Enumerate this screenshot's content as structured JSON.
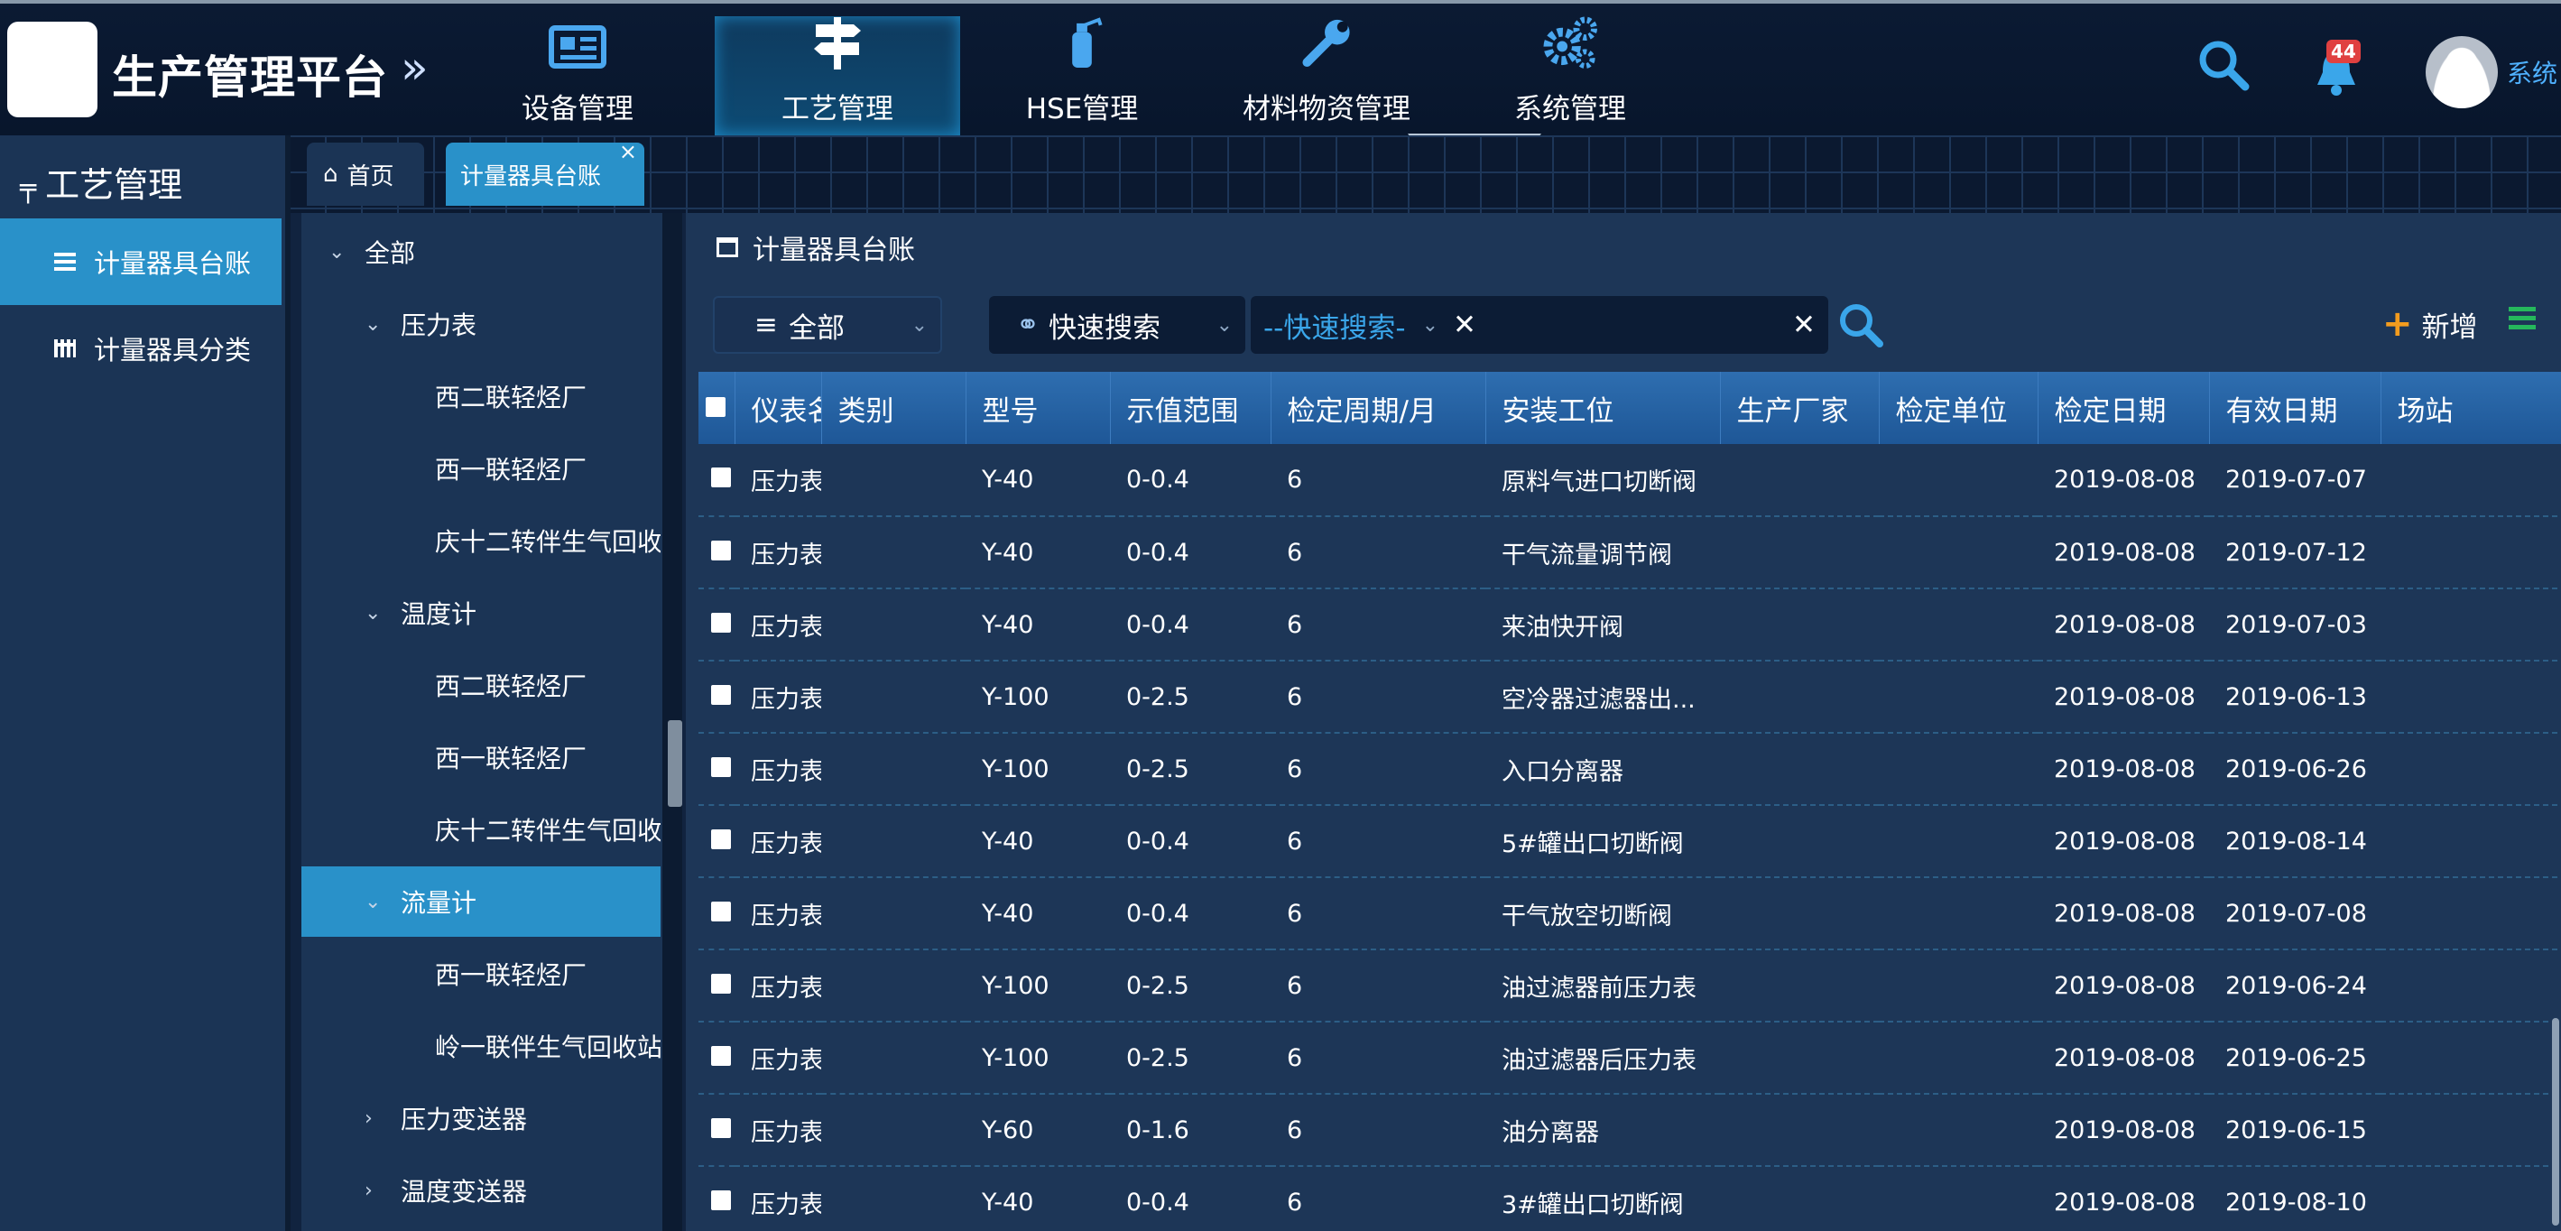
{
  "header": {
    "brand": "生产管理平台",
    "nav": [
      {
        "label": "设备管理",
        "icon": "newspaper-icon"
      },
      {
        "label": "工艺管理",
        "icon": "signpost-icon",
        "active": true
      },
      {
        "label": "HSE管理",
        "icon": "fire-extinguisher-icon"
      },
      {
        "label": "材料物资管理",
        "icon": "wrench-icon"
      },
      {
        "label": "系统管理",
        "icon": "gears-icon"
      }
    ],
    "notification_count": "44",
    "user": "系统"
  },
  "sidebar": {
    "title": "工艺管理",
    "items": [
      {
        "label": "计量器具台账",
        "active": true
      },
      {
        "label": "计量器具分类"
      }
    ]
  },
  "tabs": [
    {
      "label": "首页"
    },
    {
      "label": "计量器具台账",
      "active": true
    }
  ],
  "tree": [
    {
      "label": "全部",
      "level": 0,
      "expanded": true
    },
    {
      "label": "压力表",
      "level": 1,
      "expanded": true
    },
    {
      "label": "西二联轻烃厂",
      "level": 2
    },
    {
      "label": "西一联轻烃厂",
      "level": 2
    },
    {
      "label": "庆十二转伴生气回收站",
      "level": 2
    },
    {
      "label": "温度计",
      "level": 1,
      "expanded": true
    },
    {
      "label": "西二联轻烃厂",
      "level": 2
    },
    {
      "label": "西一联轻烃厂",
      "level": 2
    },
    {
      "label": "庆十二转伴生气回收站",
      "level": 2
    },
    {
      "label": "流量计",
      "level": 1,
      "expanded": true,
      "active": true
    },
    {
      "label": "西一联轻烃厂",
      "level": 2
    },
    {
      "label": "岭一联伴生气回收站",
      "level": 2
    },
    {
      "label": "压力变送器",
      "level": 1,
      "expanded": false
    },
    {
      "label": "温度变送器",
      "level": 1,
      "expanded": false
    }
  ],
  "main": {
    "title": "计量器具台账",
    "filter_value": "全部",
    "quick_search_label": "快速搜索",
    "search_placeholder": "--快速搜索-",
    "add_label": "新增",
    "columns": [
      "仪表名称",
      "类别",
      "型号",
      "示值范围",
      "检定周期/月",
      "安装工位",
      "生产厂家",
      "检定单位",
      "检定日期",
      "有效日期",
      "场站"
    ],
    "rows": [
      [
        "压力表",
        "",
        "Y-40",
        "0-0.4",
        "6",
        "原料气进口切断阀",
        "",
        "",
        "2019-08-08",
        "2019-07-07",
        ""
      ],
      [
        "压力表",
        "",
        "Y-40",
        "0-0.4",
        "6",
        "干气流量调节阀",
        "",
        "",
        "2019-08-08",
        "2019-07-12",
        ""
      ],
      [
        "压力表",
        "",
        "Y-40",
        "0-0.4",
        "6",
        "来油快开阀",
        "",
        "",
        "2019-08-08",
        "2019-07-03",
        ""
      ],
      [
        "压力表",
        "",
        "Y-100",
        "0-2.5",
        "6",
        "空冷器过滤器出...",
        "",
        "",
        "2019-08-08",
        "2019-06-13",
        ""
      ],
      [
        "压力表",
        "",
        "Y-100",
        "0-2.5",
        "6",
        "入口分离器",
        "",
        "",
        "2019-08-08",
        "2019-06-26",
        ""
      ],
      [
        "压力表",
        "",
        "Y-40",
        "0-0.4",
        "6",
        "5#罐出口切断阀",
        "",
        "",
        "2019-08-08",
        "2019-08-14",
        ""
      ],
      [
        "压力表",
        "",
        "Y-40",
        "0-0.4",
        "6",
        "干气放空切断阀",
        "",
        "",
        "2019-08-08",
        "2019-07-08",
        ""
      ],
      [
        "压力表",
        "",
        "Y-100",
        "0-2.5",
        "6",
        "油过滤器前压力表",
        "",
        "",
        "2019-08-08",
        "2019-06-24",
        ""
      ],
      [
        "压力表",
        "",
        "Y-100",
        "0-2.5",
        "6",
        "油过滤器后压力表",
        "",
        "",
        "2019-08-08",
        "2019-06-25",
        ""
      ],
      [
        "压力表",
        "",
        "Y-60",
        "0-1.6",
        "6",
        "油分离器",
        "",
        "",
        "2019-08-08",
        "2019-06-15",
        ""
      ],
      [
        "压力表",
        "",
        "Y-40",
        "0-0.4",
        "6",
        "3#罐出口切断阀",
        "",
        "",
        "2019-08-08",
        "2019-08-10",
        ""
      ]
    ]
  },
  "colors": {
    "accent": "#2991c9",
    "header_bg": "#08162c",
    "panel_bg": "#1b3455",
    "link": "#4fb1ff",
    "add_icon": "#f39c1e",
    "search_icon": "#3aa6ea"
  }
}
